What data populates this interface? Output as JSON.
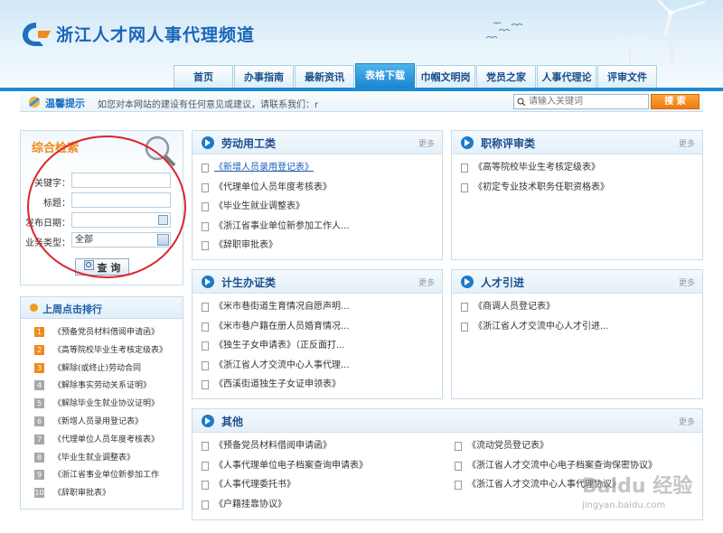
{
  "site": {
    "title": "浙江人才网人事代理频道"
  },
  "nav": [
    {
      "label": "首页"
    },
    {
      "label": "办事指南"
    },
    {
      "label": "最新资讯"
    },
    {
      "label": "表格下载",
      "active": true
    },
    {
      "label": "巾帼文明岗"
    },
    {
      "label": "党员之家"
    },
    {
      "label": "人事代理论坛"
    },
    {
      "label": "评审文件"
    }
  ],
  "notice": {
    "title": "温馨提示",
    "text": "如您对本网站的建设有任何意见或建议，请联系我们：r",
    "search_placeholder": "请输入关键词",
    "search_button": "搜 索"
  },
  "search_panel": {
    "title": "综合检索",
    "keyword_label": "关键字：",
    "title_label": "标题：",
    "date_label": "发布日期：",
    "type_label": "业务类型：",
    "type_value": "全部",
    "query_button": "查 询"
  },
  "ranking": {
    "title": "上周点击排行",
    "items": [
      {
        "num": "1",
        "text": "《预备党员材料借阅申请函》"
      },
      {
        "num": "2",
        "text": "《高等院校毕业生考核定级表》"
      },
      {
        "num": "3",
        "text": "《解除(或终止)劳动合同"
      },
      {
        "num": "4",
        "text": "《解除事实劳动关系证明》"
      },
      {
        "num": "5",
        "text": "《解除毕业生就业协议证明》"
      },
      {
        "num": "6",
        "text": "《新增人员录用登记表》"
      },
      {
        "num": "7",
        "text": "《代理单位人员年度考核表》"
      },
      {
        "num": "8",
        "text": "《毕业生就业调整表》"
      },
      {
        "num": "9",
        "text": "《浙江省事业单位新参加工作"
      },
      {
        "num": "10",
        "text": "《辞职审批表》"
      }
    ]
  },
  "more_label": "更多",
  "categories": {
    "labor": {
      "title": "劳动用工类",
      "items": [
        "《新增人员录用登记表》",
        "《代理单位人员年度考核表》",
        "《毕业生就业调整表》",
        "《浙江省事业单位新参加工作人...",
        "《辞职审批表》"
      ]
    },
    "title_review": {
      "title": "职称评审类",
      "items": [
        "《高等院校毕业生考核定级表》",
        "《初定专业技术职务任职资格表》"
      ]
    },
    "planning": {
      "title": "计生办证类",
      "items": [
        "《米市巷街道生育情况自愿声明...",
        "《米市巷户籍在册人员婚育情况...",
        "《独生子女申请表》（正反面打...",
        "《浙江省人才交流中心人事代理...",
        "《西溪街道独生子女证申领表》"
      ]
    },
    "talent": {
      "title": "人才引进",
      "items": [
        "《商调人员登记表》",
        "《浙江省人才交流中心人才引进..."
      ]
    },
    "other": {
      "title": "其他",
      "left": [
        "《预备党员材料借阅申请函》",
        "《人事代理单位电子档案查询申请表》",
        "《人事代理委托书》",
        "《户籍挂靠协议》"
      ],
      "right": [
        "《流动党员登记表》",
        "《浙江省人才交流中心电子档案查询保密协议》",
        "《浙江省人才交流中心人事代理协议》"
      ]
    }
  },
  "watermark": {
    "text": "Baidu 经验",
    "url": "jingyan.baidu.com"
  }
}
